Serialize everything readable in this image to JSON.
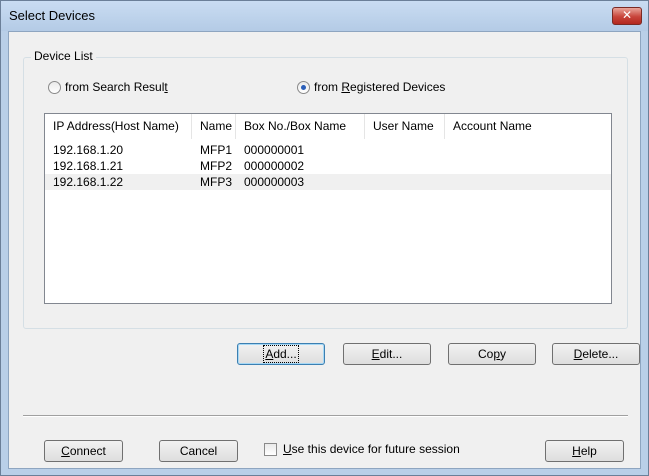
{
  "window": {
    "title": "Select Devices",
    "close_glyph": "✕"
  },
  "device_list": {
    "label": "Device List",
    "radio_search": {
      "label": "from Search Result",
      "checked": false
    },
    "radio_registered": {
      "label": "from Registered Devices",
      "checked": true
    }
  },
  "table": {
    "columns": [
      "IP Address(Host Name)",
      "Name",
      "Box No./Box Name",
      "User Name",
      "Account Name"
    ],
    "rows": [
      [
        "192.168.1.20",
        "MFP1",
        "000000001",
        "",
        ""
      ],
      [
        "192.168.1.21",
        "MFP2",
        "000000002",
        "",
        ""
      ],
      [
        "192.168.1.22",
        "MFP3",
        "000000003",
        "",
        ""
      ]
    ]
  },
  "buttons": {
    "add": "Add...",
    "edit": "Edit...",
    "copy": "Copy",
    "delete": "Delete...",
    "connect": "Connect",
    "cancel": "Cancel",
    "help": "Help"
  },
  "future_session": {
    "label": "Use this device for future session",
    "checked": false
  }
}
